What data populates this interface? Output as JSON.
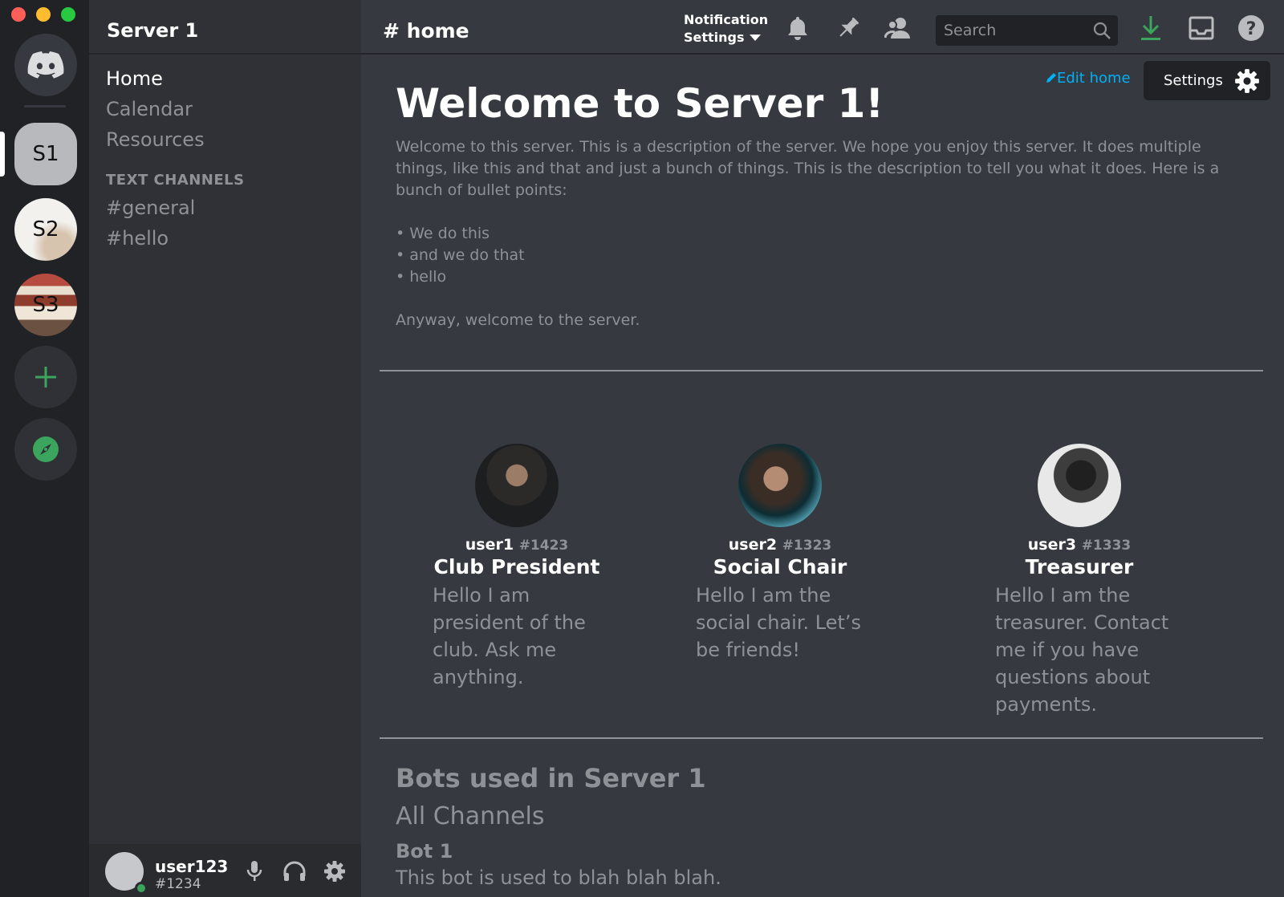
{
  "rail": {
    "servers": [
      {
        "label": "S1",
        "active": true
      },
      {
        "label": "S2"
      },
      {
        "label": "S3"
      }
    ],
    "icons": {
      "home": "discord-logo-icon",
      "add": "plus-icon",
      "explore": "compass-icon"
    },
    "accent_green": "#3ba55d"
  },
  "sidebar": {
    "server_name": "Server 1",
    "nav": [
      "Home",
      "Calendar",
      "Resources"
    ],
    "text_channels_label": "TEXT CHANNELS",
    "channels": [
      "#general",
      "#hello"
    ]
  },
  "user_panel": {
    "username": "user123",
    "tag": "#1234",
    "status_color": "#3ba55d"
  },
  "topbar": {
    "channel_title": "# home",
    "notification_settings_line1": "Notification",
    "notification_settings_line2": "Settings",
    "search_placeholder": "Search",
    "icons": [
      "bell-icon",
      "pin-icon",
      "members-icon",
      "search-icon",
      "download-icon",
      "inbox-icon",
      "help-icon"
    ]
  },
  "main": {
    "edit_home": "Edit home",
    "settings_label": "Settings",
    "welcome_title": "Welcome to Server 1!",
    "welcome_desc": "Welcome to this server. This is a description of the server. We hope you enjoy this server. It does multiple things, like this and that and just a bunch of things. This is the description to tell you what it does. Here is a bunch of bullet points:",
    "bullets": [
      "• We do this",
      "• and we do that",
      "• hello"
    ],
    "closing": "Anyway, welcome to the server.",
    "officers": [
      {
        "handle": "user1",
        "tag": "#1423",
        "role": "Club President",
        "bio": "Hello I am president of the club. Ask me anything."
      },
      {
        "handle": "user2",
        "tag": "#1323",
        "role": "Social Chair",
        "bio": "Hello I am the social chair. Let’s be friends!"
      },
      {
        "handle": "user3",
        "tag": "#1333",
        "role": "Treasurer",
        "bio": "Hello I am the treasurer. Contact me if you have questions about payments."
      }
    ],
    "bots_title": "Bots used in Server 1",
    "bots_scope": "All Channels",
    "bots": [
      {
        "name": "Bot 1",
        "description": "This bot is used to blah blah blah."
      }
    ]
  },
  "colors": {
    "link": "#00b0f4",
    "download": "#3ba55d",
    "bg_main": "#36393f",
    "bg_sidebar": "#2f3136",
    "bg_rail": "#202225"
  }
}
